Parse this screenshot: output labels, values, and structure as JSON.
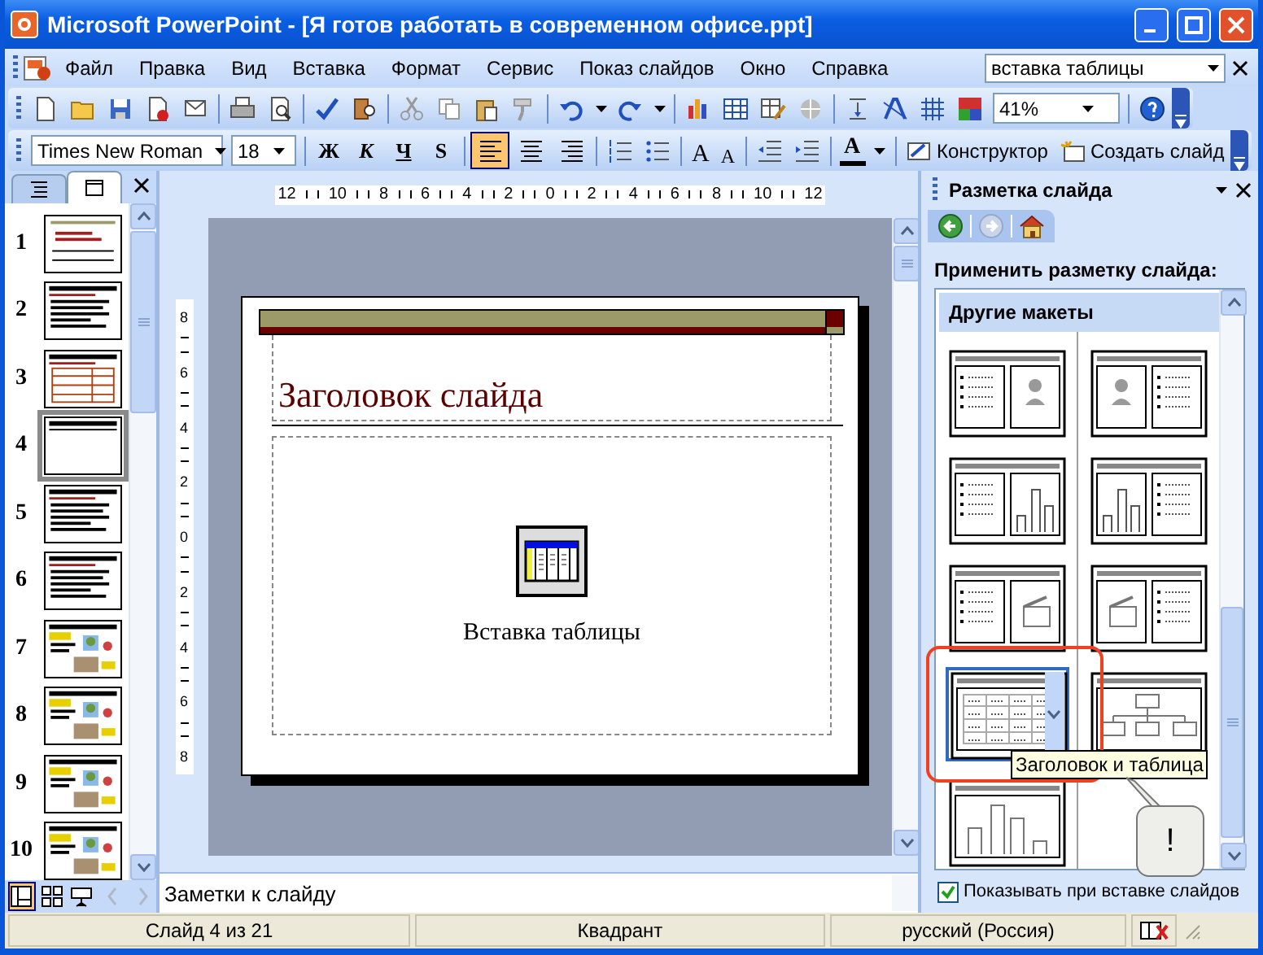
{
  "window": {
    "title": "Microsoft PowerPoint - [Я готов работать в современном офисе.ppt]"
  },
  "menu": {
    "items": [
      "Файл",
      "Правка",
      "Вид",
      "Вставка",
      "Формат",
      "Сервис",
      "Показ слайдов",
      "Окно",
      "Справка"
    ],
    "help_search": {
      "value": "вставка таблицы"
    }
  },
  "standard_toolbar": {
    "zoom": "41%"
  },
  "formatting_toolbar": {
    "font": "Times New Roman",
    "size": "18",
    "styles": [
      "Ж",
      "К",
      "Ч",
      "S"
    ],
    "align_buttons": [
      {
        "kind": "left",
        "selected": true
      },
      {
        "kind": "center",
        "selected": false
      },
      {
        "kind": "right",
        "selected": false
      }
    ],
    "grow_font": "A",
    "shrink_font": "A",
    "font_color": "A",
    "design": "Конструктор",
    "new_slide": "Создать слайд"
  },
  "slides_pane": {
    "tabs": [
      {
        "kind": "outline",
        "selected": false
      },
      {
        "kind": "slides",
        "selected": true
      }
    ],
    "slides": [
      {
        "number": "1",
        "kind": "title",
        "selected": false
      },
      {
        "number": "2",
        "kind": "bullets",
        "selected": false
      },
      {
        "number": "3",
        "kind": "table",
        "selected": false
      },
      {
        "number": "4",
        "kind": "blank",
        "selected": true
      },
      {
        "number": "5",
        "kind": "bullets",
        "selected": false
      },
      {
        "number": "6",
        "kind": "bullets",
        "selected": false
      },
      {
        "number": "7",
        "kind": "pictures",
        "selected": false
      },
      {
        "number": "8",
        "kind": "pictures",
        "selected": false
      },
      {
        "number": "9",
        "kind": "pictures",
        "selected": false
      },
      {
        "number": "10",
        "kind": "pictures",
        "selected": false
      }
    ],
    "view_buttons": [
      {
        "kind": "normal",
        "selected": true
      },
      {
        "kind": "sorter",
        "selected": false
      },
      {
        "kind": "show",
        "selected": false
      }
    ]
  },
  "editor": {
    "hruler": [
      "12",
      "10",
      "8",
      "6",
      "4",
      "2",
      "0",
      "2",
      "4",
      "6",
      "8",
      "10",
      "12"
    ],
    "vruler": [
      "8",
      "6",
      "4",
      "2",
      "0",
      "2",
      "4",
      "6",
      "8"
    ],
    "slide": {
      "title": "Заголовок слайда",
      "caption": "Вставка таблицы"
    },
    "notes": {
      "text": "Заметки к слайду"
    }
  },
  "task_pane": {
    "title": "Разметка слайда",
    "apply_label": "Применить разметку слайда:",
    "section": "Другие макеты",
    "layouts": [
      {
        "kind": "text-picture",
        "selected": false
      },
      {
        "kind": "picture-text",
        "selected": false
      },
      {
        "kind": "text-chart",
        "selected": false
      },
      {
        "kind": "chart-text",
        "selected": false
      },
      {
        "kind": "text-media",
        "selected": false
      },
      {
        "kind": "media-text",
        "selected": false
      },
      {
        "kind": "title-table",
        "selected": true
      },
      {
        "kind": "title-diagram",
        "selected": false
      },
      {
        "kind": "title-chart",
        "selected": false
      }
    ],
    "tooltip": "Заголовок и таблица",
    "show_on_insert": {
      "label": "Показывать при вставке слайдов",
      "checked": true
    }
  },
  "callout": {
    "text": "!"
  },
  "status_bar": [
    "Слайд 4 из 21",
    "Квадрант",
    "русский (Россия)"
  ]
}
